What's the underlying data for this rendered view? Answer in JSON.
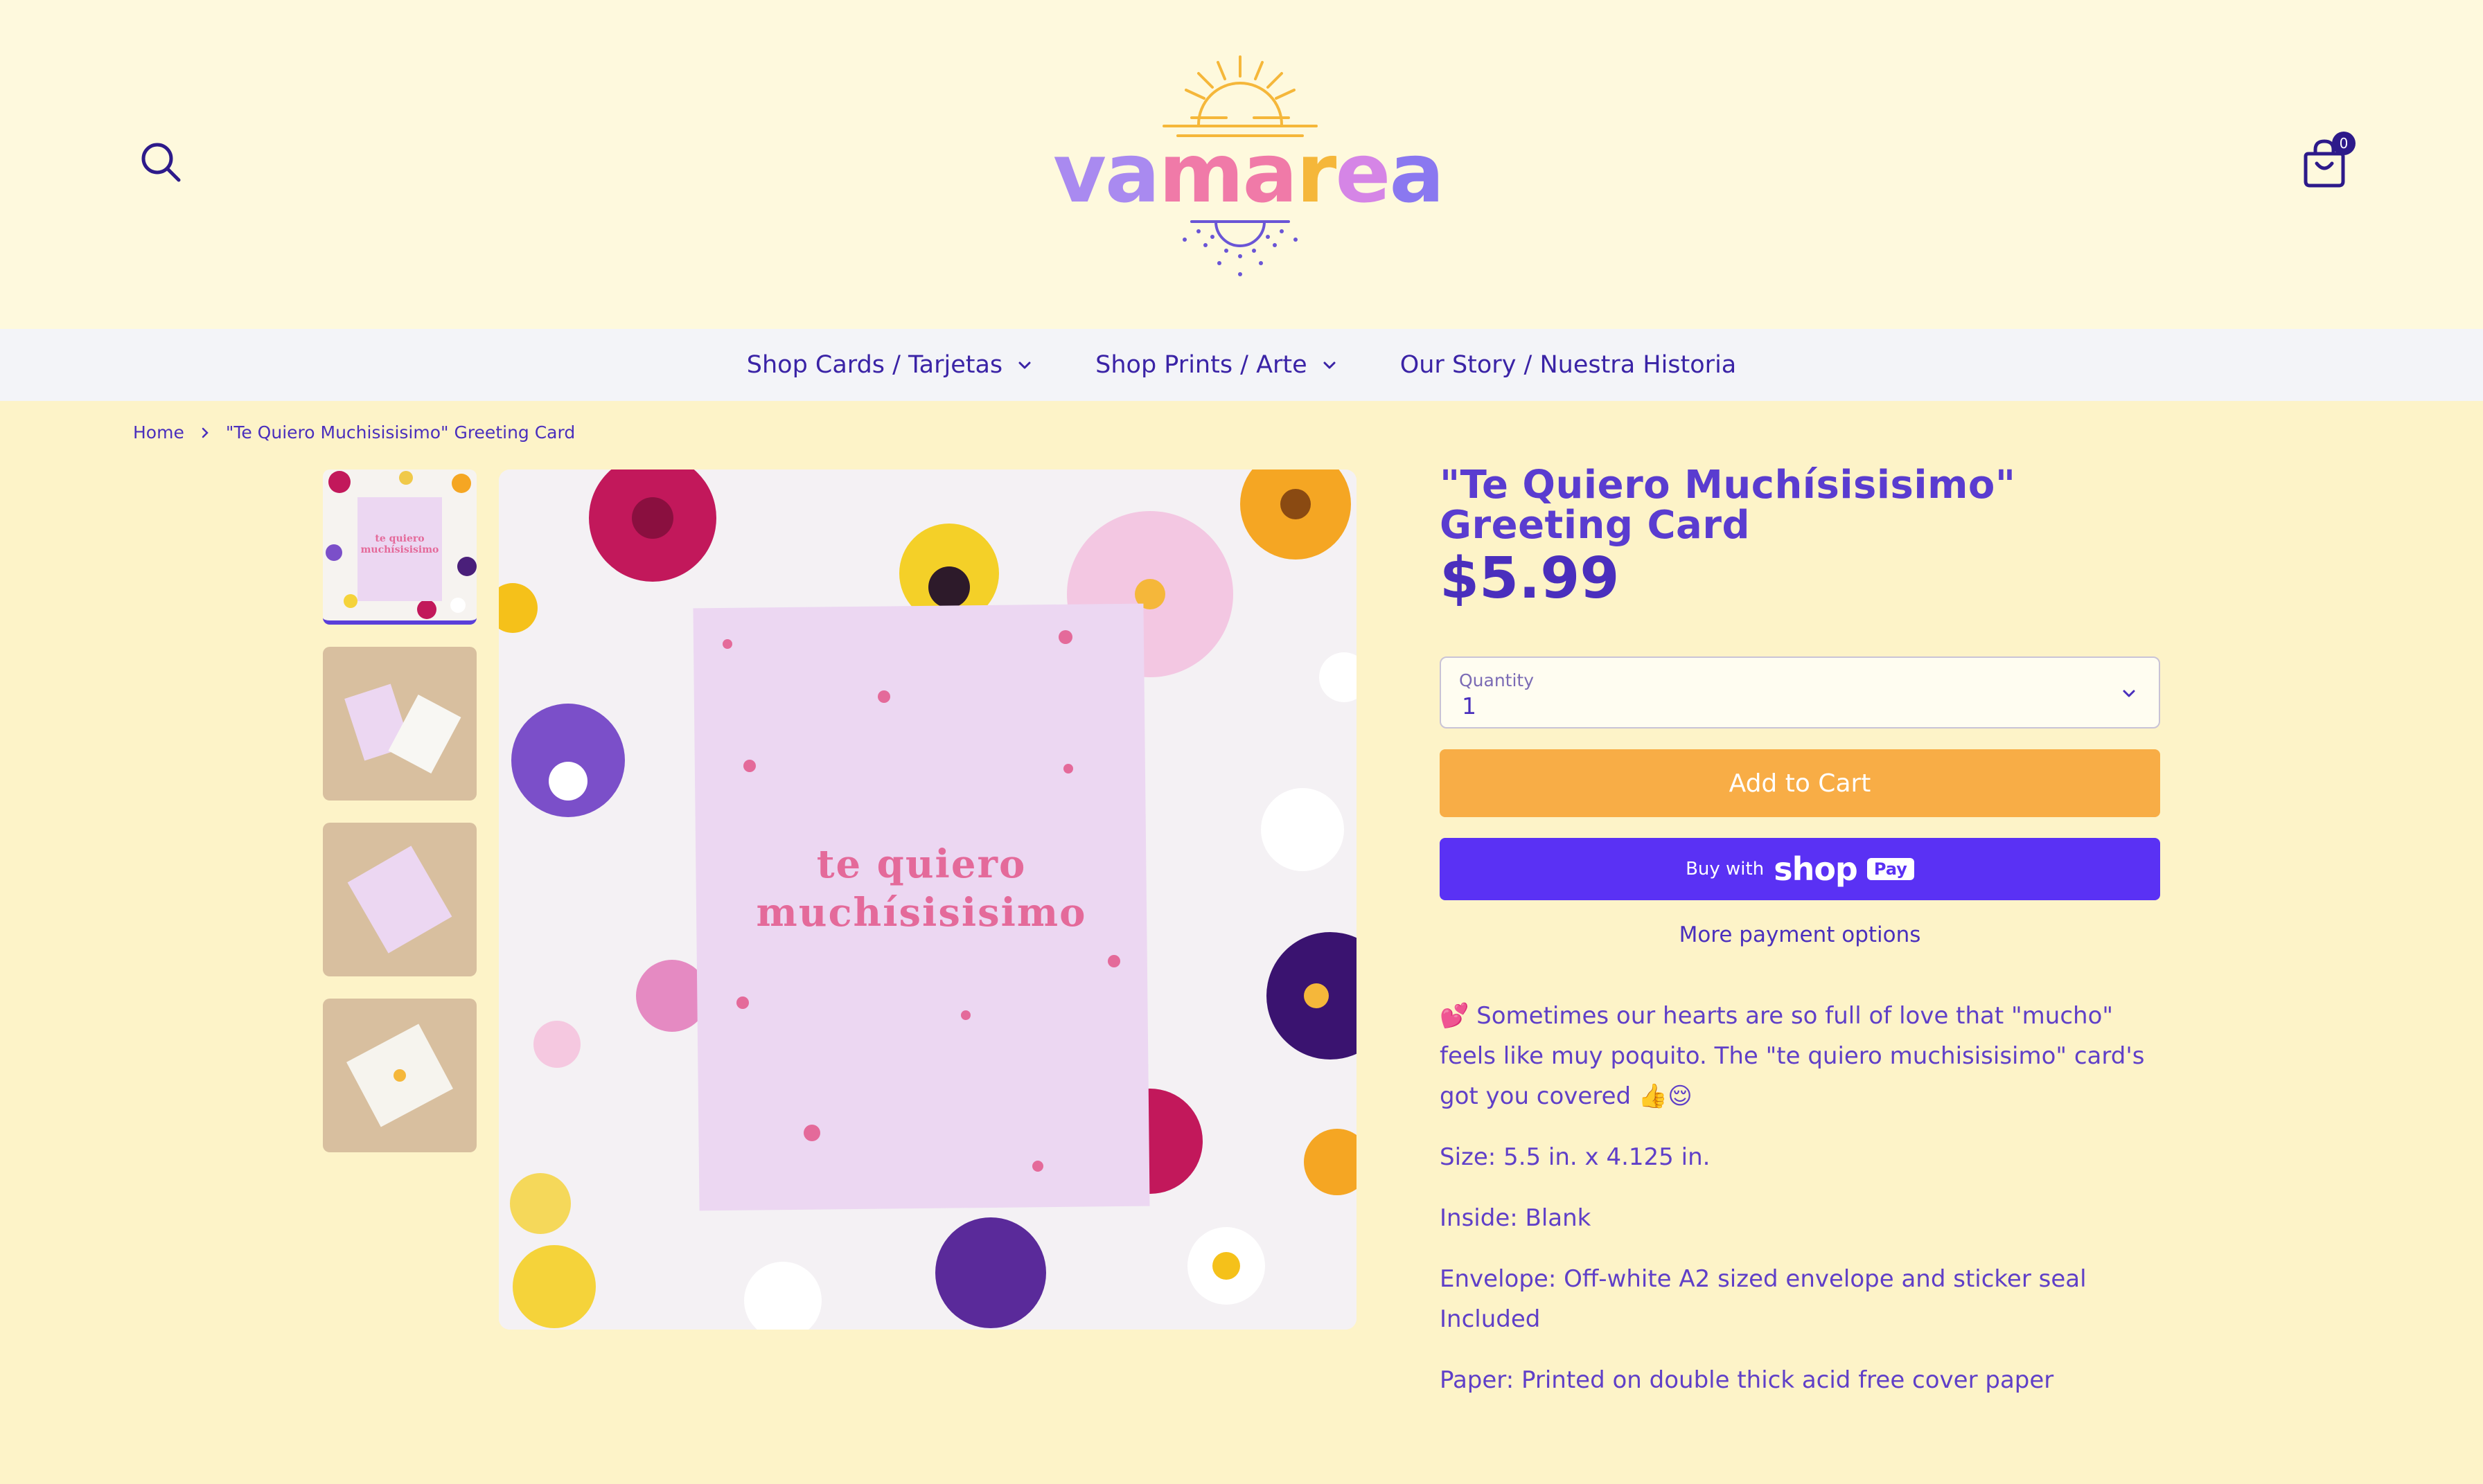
{
  "header": {
    "logo_text": "vamarea",
    "cart_count": "0"
  },
  "nav": {
    "items": [
      {
        "label": "Shop Cards / Tarjetas"
      },
      {
        "label": "Shop Prints / Arte"
      },
      {
        "label": "Our Story / Nuestra Historia"
      }
    ]
  },
  "breadcrumb": {
    "home": "Home",
    "current": "\"Te Quiero Muchisisisimo\" Greeting Card"
  },
  "product": {
    "title": "\"Te Quiero Muchísisisimo\" Greeting Card",
    "price": "$5.99",
    "card_text_line1": "te quiero",
    "card_text_line2": "muchísisisimo",
    "thumb_text_line1": "te quiero",
    "thumb_text_line2": "muchísisisimo",
    "quantity_label": "Quantity",
    "quantity_value": "1",
    "add_to_cart": "Add to Cart",
    "buy_with": "Buy with",
    "shop": "shop",
    "pay": "Pay",
    "more_payment": "More payment options",
    "description_lead": "💕 Sometimes our hearts are so full of love that \"mucho\" feels like muy poquito.  The \"te quiero muchisisisimo\" card's got you covered 👍😌",
    "size": "Size: 5.5 in. x 4.125 in.",
    "inside": "Inside: Blank",
    "envelope": "Envelope: Off-white A2 sized envelope and sticker seal Included",
    "paper": "Paper: Printed on double thick acid free cover paper"
  },
  "colors": {
    "accent": "#4a2fbd",
    "cart_button": "#f8ad46",
    "shoppay": "#5a31f4",
    "background": "#fdf3c8"
  }
}
